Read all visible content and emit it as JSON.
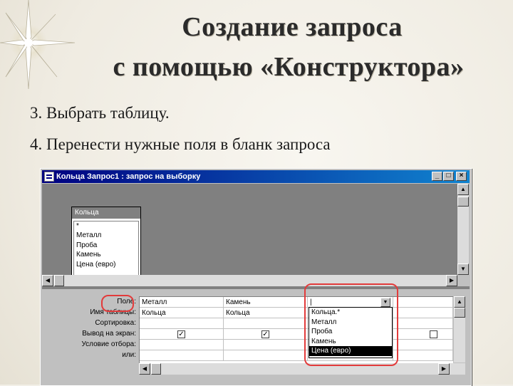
{
  "slide": {
    "title_line1": "Создание запроса",
    "title_line2": "с помощью «Конструктора»",
    "steps": [
      "3. Выбрать таблицу.",
      "4. Перенести нужные поля в бланк запроса"
    ]
  },
  "window": {
    "title": "Кольца Запрос1 : запрос на выборку",
    "controls": {
      "minimize": "_",
      "maximize": "□",
      "close": "×"
    }
  },
  "table": {
    "name": "Кольца",
    "fields": [
      "*",
      "Металл",
      "Проба",
      "Камень",
      "Цена (евро)"
    ]
  },
  "grid": {
    "row_labels": [
      "Поле:",
      "Имя таблицы:",
      "Сортировка:",
      "Вывод на экран:",
      "Условие отбора:",
      "или:"
    ],
    "columns": [
      {
        "field": "Металл",
        "table": "Кольца",
        "show": true
      },
      {
        "field": "Камень",
        "table": "Кольца",
        "show": true
      },
      {
        "field": "",
        "table": "",
        "show": false
      }
    ],
    "dropdown_options": [
      "Кольца.*",
      "Металл",
      "Проба",
      "Камень",
      "Цена (евро)"
    ],
    "dropdown_selected": "Цена (евро)"
  },
  "colors": {
    "highlight": "#e23b3b",
    "titlebar": "#000080"
  }
}
